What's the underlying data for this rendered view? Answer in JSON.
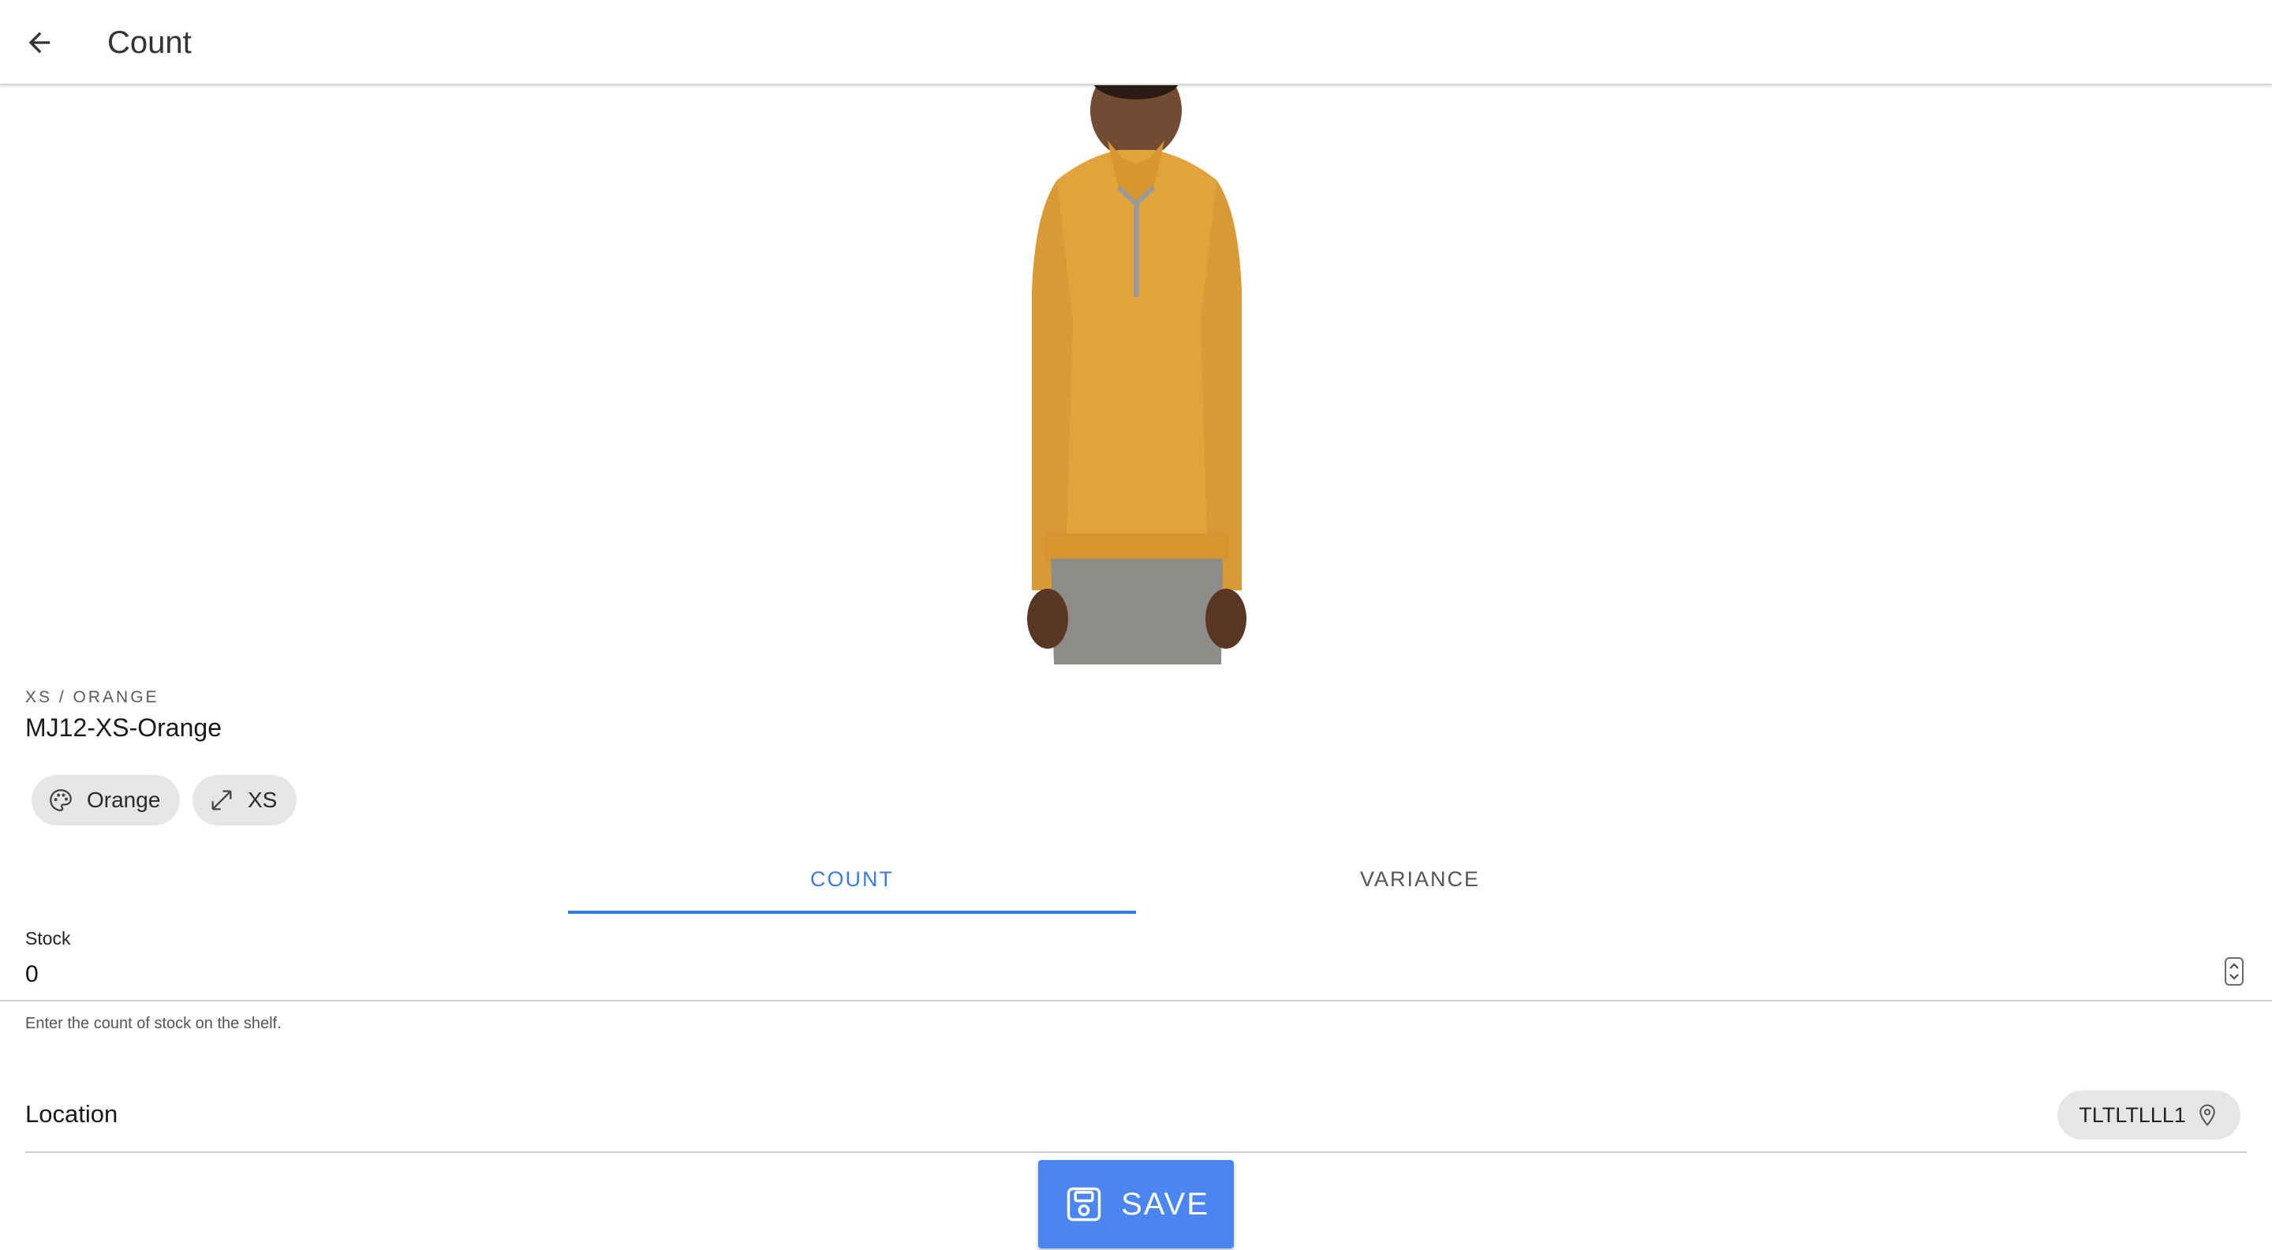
{
  "header": {
    "title": "Count",
    "back_icon": "arrow-left-icon"
  },
  "product": {
    "variant_label": "XS / ORANGE",
    "sku": "MJ12-XS-Orange",
    "image_icon": "product-photo-orange-quarter-zip",
    "chips": [
      {
        "label": "Orange",
        "icon": "palette-icon"
      },
      {
        "label": "XS",
        "icon": "resize-arrows-icon"
      }
    ]
  },
  "tabs": [
    {
      "label": "COUNT",
      "active": true
    },
    {
      "label": "VARIANCE",
      "active": false
    }
  ],
  "stock": {
    "label": "Stock",
    "value": "0",
    "helper": "Enter the count of stock on the shelf."
  },
  "location": {
    "label": "Location",
    "value": "TLTLTLLL1",
    "icon": "map-pin-icon"
  },
  "save": {
    "label": "SAVE",
    "icon": "floppy-disk-icon"
  },
  "colors": {
    "accent": "#3b7be8",
    "button": "#4b86f0",
    "chip_bg": "#e6e6e6",
    "shirt": "#e2a23c"
  }
}
